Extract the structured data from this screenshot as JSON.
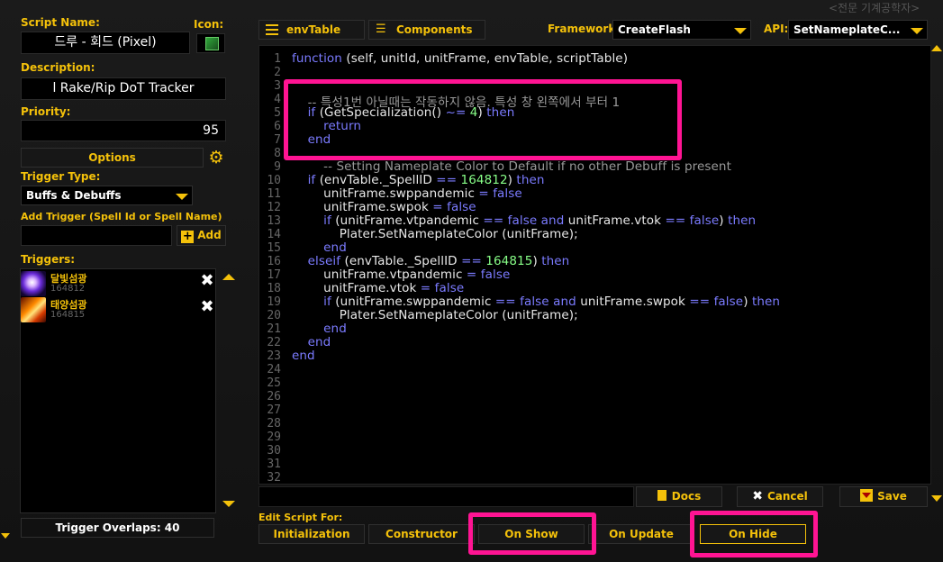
{
  "colors": {
    "accent": "#f4c10a",
    "highlight": "#ff1493",
    "keyword": "#7b7bff",
    "number": "#88ff88",
    "comment": "#9a9a9a"
  },
  "corner_text": "<전문 기계공학자>",
  "sidebar": {
    "script_name_label": "Script Name:",
    "script_name_value": "드루 - 회드 (Pixel)",
    "icon_label": "Icon:",
    "description_label": "Description:",
    "description_value": "l Rake/Rip DoT Tracker",
    "priority_label": "Priority:",
    "priority_value": "95",
    "options_label": "Options",
    "trigger_type_label": "Trigger Type:",
    "trigger_type_value": "Buffs & Debuffs",
    "add_trigger_label": "Add Trigger (Spell Id or Spell Name)",
    "add_button_label": "Add",
    "triggers_label": "Triggers:",
    "triggers": [
      {
        "name": "달빛섬광",
        "id": "164812"
      },
      {
        "name": "태양섬광",
        "id": "164815"
      }
    ],
    "trigger_overlaps": "Trigger Overlaps: 40"
  },
  "toolbar": {
    "env_table_label": "envTable",
    "components_label": "Components",
    "framework_label": "Framework:",
    "framework_value": "CreateFlash",
    "api_label": "API:",
    "api_value": "SetNameplateC..."
  },
  "editor": {
    "line_numbers": [
      "1",
      "2",
      "3",
      "4",
      "5",
      "6",
      "7",
      "8",
      "9",
      "10",
      "11",
      "12",
      "13",
      "14",
      "15",
      "16",
      "17",
      "18",
      "19",
      "20",
      "21",
      "22",
      "23",
      "24",
      "25",
      "26",
      "27",
      "28",
      "29",
      "30",
      "31",
      "32"
    ],
    "lines": [
      [
        {
          "t": "function",
          "c": "kw"
        },
        {
          "t": " (self, unitId, unitFrame, envTable, scriptTable)",
          "c": ""
        }
      ],
      [],
      [],
      [
        {
          "t": "    -- 특성1번 아닐때는 작동하지 않음. 특성 창 왼쪽에서 부터 1",
          "c": "cm"
        }
      ],
      [
        {
          "t": "    ",
          "c": ""
        },
        {
          "t": "if",
          "c": "kw"
        },
        {
          "t": " (GetSpecialization() ",
          "c": ""
        },
        {
          "t": "~=",
          "c": "kw"
        },
        {
          "t": " ",
          "c": ""
        },
        {
          "t": "4",
          "c": "num"
        },
        {
          "t": ") ",
          "c": ""
        },
        {
          "t": "then",
          "c": "kw"
        }
      ],
      [
        {
          "t": "        ",
          "c": ""
        },
        {
          "t": "return",
          "c": "kw"
        }
      ],
      [
        {
          "t": "    ",
          "c": ""
        },
        {
          "t": "end",
          "c": "kw"
        }
      ],
      [],
      [
        {
          "t": "        -- Setting Nameplate Color to Default if no other Debuff is present",
          "c": "cm"
        }
      ],
      [
        {
          "t": "    ",
          "c": ""
        },
        {
          "t": "if",
          "c": "kw"
        },
        {
          "t": " (envTable._SpellID ",
          "c": ""
        },
        {
          "t": "==",
          "c": "kw"
        },
        {
          "t": " ",
          "c": ""
        },
        {
          "t": "164812",
          "c": "num"
        },
        {
          "t": ") ",
          "c": ""
        },
        {
          "t": "then",
          "c": "kw"
        }
      ],
      [
        {
          "t": "        unitFrame.swppandemic ",
          "c": ""
        },
        {
          "t": "=",
          "c": "kw"
        },
        {
          "t": " ",
          "c": ""
        },
        {
          "t": "false",
          "c": "kw"
        }
      ],
      [
        {
          "t": "        unitFrame.swpok ",
          "c": ""
        },
        {
          "t": "=",
          "c": "kw"
        },
        {
          "t": " ",
          "c": ""
        },
        {
          "t": "false",
          "c": "kw"
        }
      ],
      [
        {
          "t": "        ",
          "c": ""
        },
        {
          "t": "if",
          "c": "kw"
        },
        {
          "t": " (unitFrame.vtpandemic ",
          "c": ""
        },
        {
          "t": "==",
          "c": "kw"
        },
        {
          "t": " ",
          "c": ""
        },
        {
          "t": "false",
          "c": "kw"
        },
        {
          "t": " ",
          "c": ""
        },
        {
          "t": "and",
          "c": "kw"
        },
        {
          "t": " unitFrame.vtok ",
          "c": ""
        },
        {
          "t": "==",
          "c": "kw"
        },
        {
          "t": " ",
          "c": ""
        },
        {
          "t": "false",
          "c": "kw"
        },
        {
          "t": ") ",
          "c": ""
        },
        {
          "t": "then",
          "c": "kw"
        }
      ],
      [
        {
          "t": "            Plater.SetNameplateColor (unitFrame);",
          "c": ""
        }
      ],
      [
        {
          "t": "        ",
          "c": ""
        },
        {
          "t": "end",
          "c": "kw"
        }
      ],
      [
        {
          "t": "    ",
          "c": ""
        },
        {
          "t": "elseif",
          "c": "kw"
        },
        {
          "t": " (envTable._SpellID ",
          "c": ""
        },
        {
          "t": "==",
          "c": "kw"
        },
        {
          "t": " ",
          "c": ""
        },
        {
          "t": "164815",
          "c": "num"
        },
        {
          "t": ") ",
          "c": ""
        },
        {
          "t": "then",
          "c": "kw"
        }
      ],
      [
        {
          "t": "        unitFrame.vtpandemic ",
          "c": ""
        },
        {
          "t": "=",
          "c": "kw"
        },
        {
          "t": " ",
          "c": ""
        },
        {
          "t": "false",
          "c": "kw"
        }
      ],
      [
        {
          "t": "        unitFrame.vtok ",
          "c": ""
        },
        {
          "t": "=",
          "c": "kw"
        },
        {
          "t": " ",
          "c": ""
        },
        {
          "t": "false",
          "c": "kw"
        }
      ],
      [
        {
          "t": "        ",
          "c": ""
        },
        {
          "t": "if",
          "c": "kw"
        },
        {
          "t": " (unitFrame.swppandemic ",
          "c": ""
        },
        {
          "t": "==",
          "c": "kw"
        },
        {
          "t": " ",
          "c": ""
        },
        {
          "t": "false",
          "c": "kw"
        },
        {
          "t": " ",
          "c": ""
        },
        {
          "t": "and",
          "c": "kw"
        },
        {
          "t": " unitFrame.swpok ",
          "c": ""
        },
        {
          "t": "==",
          "c": "kw"
        },
        {
          "t": " ",
          "c": ""
        },
        {
          "t": "false",
          "c": "kw"
        },
        {
          "t": ") ",
          "c": ""
        },
        {
          "t": "then",
          "c": "kw"
        }
      ],
      [
        {
          "t": "            Plater.SetNameplateColor (unitFrame);",
          "c": ""
        }
      ],
      [
        {
          "t": "        ",
          "c": ""
        },
        {
          "t": "end",
          "c": "kw"
        }
      ],
      [
        {
          "t": "    ",
          "c": ""
        },
        {
          "t": "end",
          "c": "kw"
        }
      ],
      [
        {
          "t": "end",
          "c": "kw"
        }
      ]
    ]
  },
  "bottom_bar": {
    "docs_label": "Docs",
    "cancel_label": "Cancel",
    "save_label": "Save",
    "edit_script_for_label": "Edit Script For:",
    "tabs": [
      "Initialization",
      "Constructor",
      "On Show",
      "On Update",
      "On Hide"
    ]
  }
}
